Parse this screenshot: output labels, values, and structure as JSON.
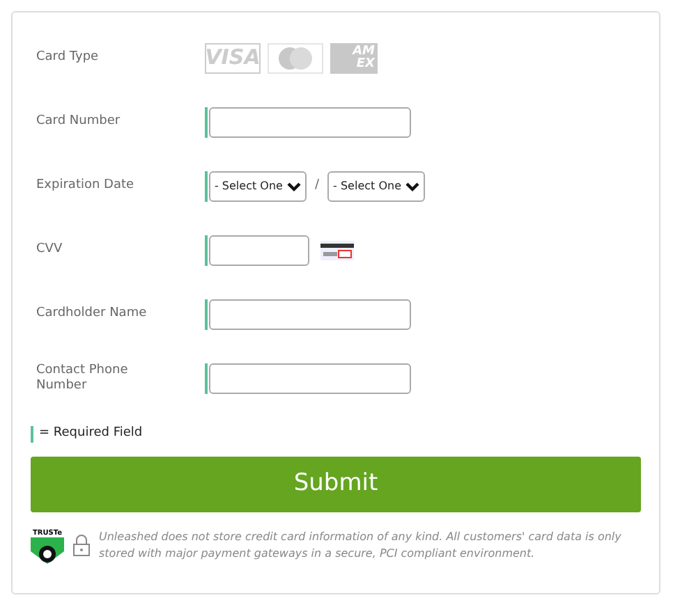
{
  "card_type": {
    "label": "Card Type",
    "logos": [
      {
        "kind": "visa",
        "text": "VISA"
      },
      {
        "kind": "mastercard"
      },
      {
        "kind": "amex",
        "lines": [
          "AM",
          "EX"
        ]
      }
    ]
  },
  "fields": [
    {
      "kind": "text",
      "label": "Card Number",
      "required": true
    },
    {
      "kind": "date",
      "label": "Expiration Date",
      "required": true,
      "month": "- Select One",
      "separator": "/",
      "year": "- Select One"
    },
    {
      "kind": "cvv",
      "label": "CVV",
      "required": true
    },
    {
      "kind": "text",
      "label": "Cardholder Name",
      "required": true
    },
    {
      "kind": "text",
      "label": "Contact Phone Number",
      "required": true
    }
  ],
  "legend": "= Required Field",
  "submit": "Submit",
  "trust_badge": "TRUSTe",
  "notice": "Unleashed does not store credit card information of any kind. All customers' card data is only stored with major payment gateways in a secure, PCI compliant environment."
}
